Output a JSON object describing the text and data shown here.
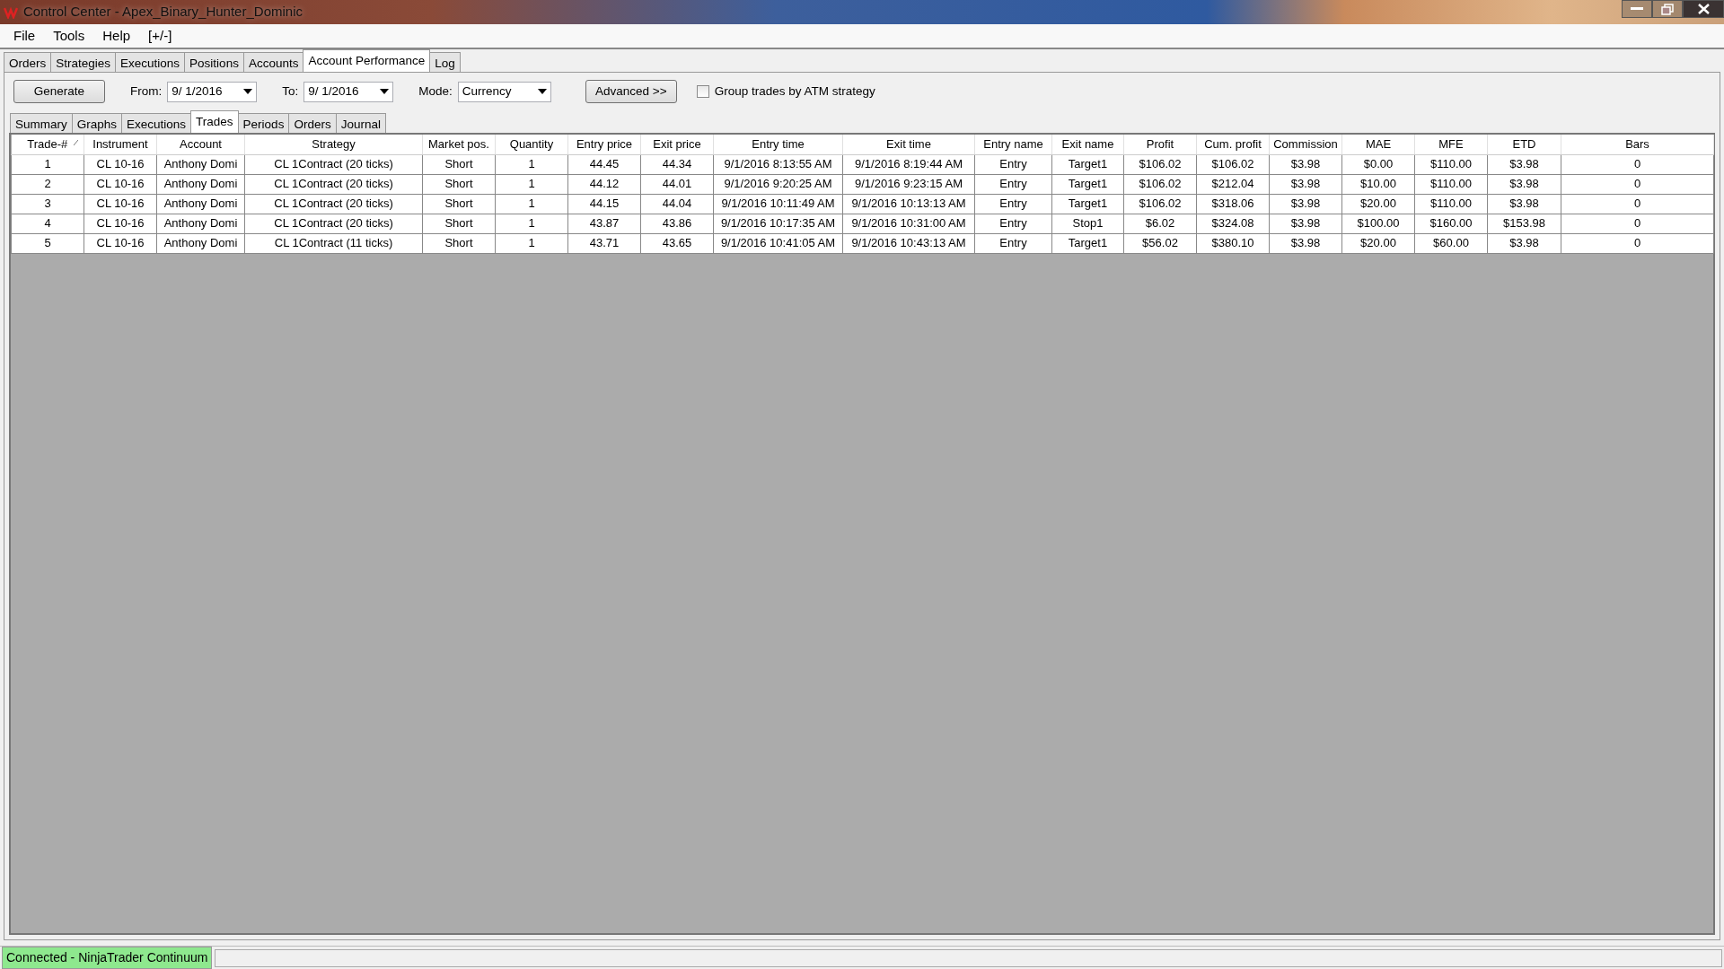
{
  "window": {
    "title": "Control Center - Apex_Binary_Hunter_Dominic"
  },
  "menu": [
    "File",
    "Tools",
    "Help",
    "[+/-]"
  ],
  "tabs": [
    {
      "label": "Orders",
      "selected": false
    },
    {
      "label": "Strategies",
      "selected": false
    },
    {
      "label": "Executions",
      "selected": false
    },
    {
      "label": "Positions",
      "selected": false
    },
    {
      "label": "Accounts",
      "selected": false
    },
    {
      "label": "Account Performance",
      "selected": true
    },
    {
      "label": "Log",
      "selected": false
    }
  ],
  "toolbar": {
    "generate": "Generate",
    "from_label": "From:",
    "from_value": "9/  1/2016",
    "to_label": "To:",
    "to_value": "9/  1/2016",
    "mode_label": "Mode:",
    "mode_value": "Currency",
    "advanced": "Advanced >>",
    "group_checkbox": {
      "label": "Group trades by ATM strategy",
      "checked": false
    }
  },
  "subtabs": [
    {
      "label": "Summary",
      "selected": false
    },
    {
      "label": "Graphs",
      "selected": false
    },
    {
      "label": "Executions",
      "selected": false
    },
    {
      "label": "Trades",
      "selected": true
    },
    {
      "label": "Periods",
      "selected": false
    },
    {
      "label": "Orders",
      "selected": false
    },
    {
      "label": "Journal",
      "selected": false
    }
  ],
  "table": {
    "columns": [
      {
        "label": "Trade-#",
        "sorted": true
      },
      {
        "label": "Instrument",
        "sorted": false
      },
      {
        "label": "Account",
        "sorted": false
      },
      {
        "label": "Strategy",
        "sorted": false
      },
      {
        "label": "Market pos.",
        "sorted": false
      },
      {
        "label": "Quantity",
        "sorted": false
      },
      {
        "label": "Entry price",
        "sorted": false
      },
      {
        "label": "Exit price",
        "sorted": false
      },
      {
        "label": "Entry time",
        "sorted": false
      },
      {
        "label": "Exit time",
        "sorted": false
      },
      {
        "label": "Entry name",
        "sorted": false
      },
      {
        "label": "Exit name",
        "sorted": false
      },
      {
        "label": "Profit",
        "sorted": false
      },
      {
        "label": "Cum. profit",
        "sorted": false
      },
      {
        "label": "Commission",
        "sorted": false
      },
      {
        "label": "MAE",
        "sorted": false
      },
      {
        "label": "MFE",
        "sorted": false
      },
      {
        "label": "ETD",
        "sorted": false
      },
      {
        "label": "Bars",
        "sorted": false
      }
    ],
    "rows": [
      [
        "1",
        "CL 10-16",
        "Anthony Domi",
        "CL 1Contract (20 ticks)",
        "Short",
        "1",
        "44.45",
        "44.34",
        "9/1/2016 8:13:55 AM",
        "9/1/2016 8:19:44 AM",
        "Entry",
        "Target1",
        "$106.02",
        "$106.02",
        "$3.98",
        "$0.00",
        "$110.00",
        "$3.98",
        "0"
      ],
      [
        "2",
        "CL 10-16",
        "Anthony Domi",
        "CL 1Contract (20 ticks)",
        "Short",
        "1",
        "44.12",
        "44.01",
        "9/1/2016 9:20:25 AM",
        "9/1/2016 9:23:15 AM",
        "Entry",
        "Target1",
        "$106.02",
        "$212.04",
        "$3.98",
        "$10.00",
        "$110.00",
        "$3.98",
        "0"
      ],
      [
        "3",
        "CL 10-16",
        "Anthony Domi",
        "CL 1Contract (20 ticks)",
        "Short",
        "1",
        "44.15",
        "44.04",
        "9/1/2016 10:11:49 AM",
        "9/1/2016 10:13:13 AM",
        "Entry",
        "Target1",
        "$106.02",
        "$318.06",
        "$3.98",
        "$20.00",
        "$110.00",
        "$3.98",
        "0"
      ],
      [
        "4",
        "CL 10-16",
        "Anthony Domi",
        "CL 1Contract (20 ticks)",
        "Short",
        "1",
        "43.87",
        "43.86",
        "9/1/2016 10:17:35 AM",
        "9/1/2016 10:31:00 AM",
        "Entry",
        "Stop1",
        "$6.02",
        "$324.08",
        "$3.98",
        "$100.00",
        "$160.00",
        "$153.98",
        "0"
      ],
      [
        "5",
        "CL 10-16",
        "Anthony Domi",
        "CL 1Contract (11 ticks)",
        "Short",
        "1",
        "43.71",
        "43.65",
        "9/1/2016 10:41:05 AM",
        "9/1/2016 10:43:13 AM",
        "Entry",
        "Target1",
        "$56.02",
        "$380.10",
        "$3.98",
        "$20.00",
        "$60.00",
        "$3.98",
        "0"
      ]
    ]
  },
  "status_bar": {
    "text": "Connected - NinjaTrader Continuum",
    "connected": true
  }
}
